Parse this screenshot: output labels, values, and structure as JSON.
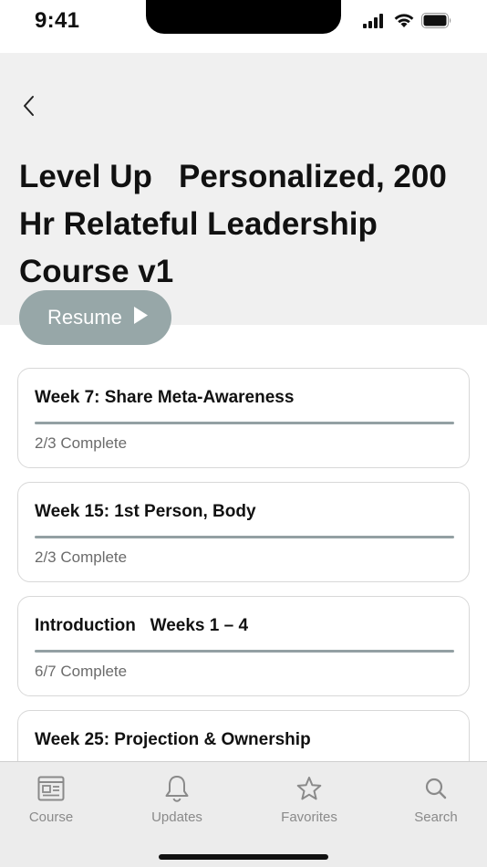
{
  "status_bar": {
    "time": "9:41"
  },
  "header": {
    "back_icon": "chevron-left-icon",
    "title": "Level Up   Personalized, 200 Hr Relateful Leadership Course v1",
    "resume_label": "Resume",
    "resume_icon": "play-icon",
    "background_color": "#f0f0f0",
    "accent_color": "#97a7a8"
  },
  "modules": [
    {
      "title": "Week 7: Share Meta-Awareness",
      "status": "2/3 Complete",
      "progress": 1.0
    },
    {
      "title": "Week 15: 1st Person, Body",
      "status": "2/3 Complete",
      "progress": 1.0
    },
    {
      "title": "Introduction   Weeks 1 – 4",
      "status": "6/7 Complete",
      "progress": 1.0
    },
    {
      "title": "Week 25: Projection & Ownership",
      "status": "",
      "progress": null
    }
  ],
  "tab_bar": {
    "items": [
      {
        "label": "Course",
        "icon": "course-icon",
        "selected": true
      },
      {
        "label": "Updates",
        "icon": "bell-icon",
        "selected": false
      },
      {
        "label": "Favorites",
        "icon": "star-icon",
        "selected": false
      },
      {
        "label": "Search",
        "icon": "search-icon",
        "selected": false
      }
    ]
  }
}
